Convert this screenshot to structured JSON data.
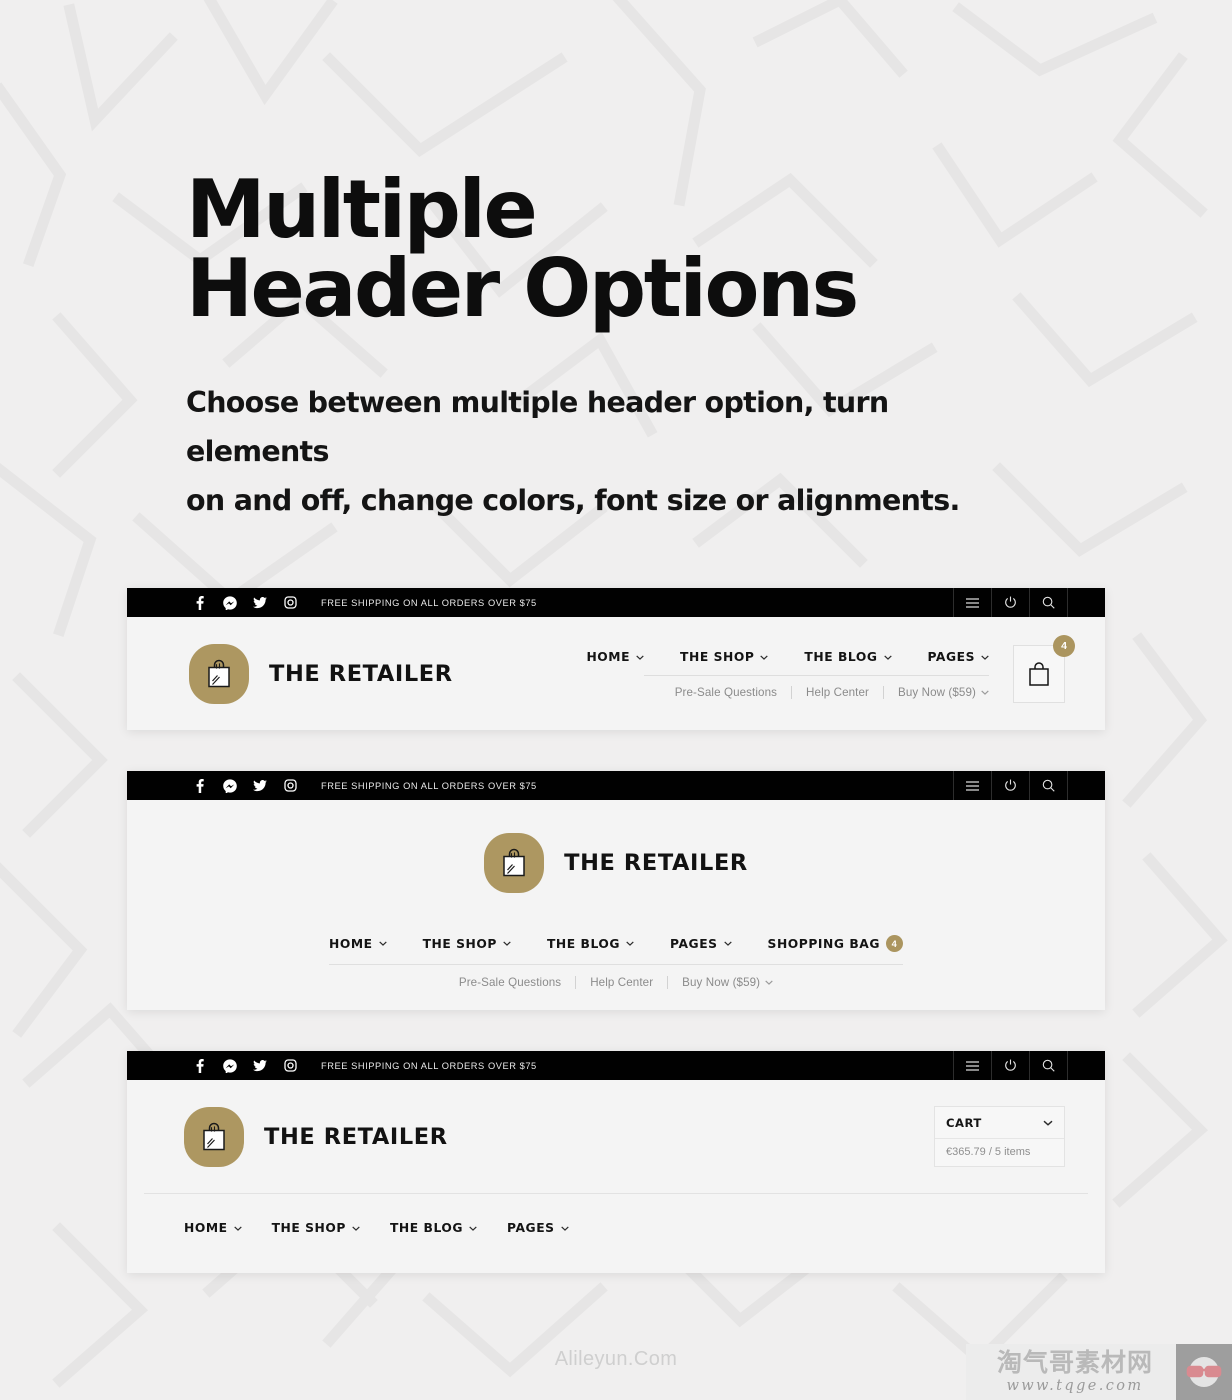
{
  "hero": {
    "title_line1": "Multiple",
    "title_line2": "Header Options",
    "subtitle_line1": "Choose between multiple header option, turn elements",
    "subtitle_line2": "on and off, change colors, font size or alignments."
  },
  "colors": {
    "page_background": "#f0efef",
    "card_background": "#f4f4f4",
    "topbar_background": "#010101",
    "brand_gold": "#ad9761",
    "badge_gold": "#ab955f",
    "text_dark": "#121212",
    "text_muted": "#8b8b8b"
  },
  "topbar": {
    "shipping_notice": "FREE SHIPPING ON ALL ORDERS OVER $75",
    "social": [
      {
        "name": "facebook-icon",
        "label": "Facebook"
      },
      {
        "name": "messenger-icon",
        "label": "Messenger"
      },
      {
        "name": "twitter-icon",
        "label": "Twitter"
      },
      {
        "name": "instagram-icon",
        "label": "Instagram"
      }
    ],
    "actions": [
      {
        "name": "menu-icon",
        "label": "Menu"
      },
      {
        "name": "power-icon",
        "label": "Login"
      },
      {
        "name": "search-icon",
        "label": "Search"
      }
    ]
  },
  "brand": {
    "name": "THE RETAILER",
    "logo_icon": "shopping-bag-icon"
  },
  "nav": {
    "primary": [
      {
        "label": "HOME",
        "has_caret": true
      },
      {
        "label": "THE SHOP",
        "has_caret": true
      },
      {
        "label": "THE BLOG",
        "has_caret": true
      },
      {
        "label": "PAGES",
        "has_caret": true
      }
    ],
    "secondary": [
      {
        "label": "Pre-Sale Questions",
        "has_caret": false
      },
      {
        "label": "Help Center",
        "has_caret": false
      },
      {
        "label": "Buy Now ($59)",
        "has_caret": true
      }
    ],
    "shopping_bag_label": "SHOPPING BAG",
    "bag_count": "4"
  },
  "header1": {
    "cart_count": "4",
    "cart_icon": "shopping-bag-icon"
  },
  "header3": {
    "cart_label": "CART",
    "cart_summary": "€365.79 / 5 items"
  },
  "watermarks": {
    "center_text": "Alileyun.Com",
    "badge_cn": "淘气哥素材网",
    "badge_url": "www.tqge.com",
    "badge_icon": "glasses-icon"
  }
}
